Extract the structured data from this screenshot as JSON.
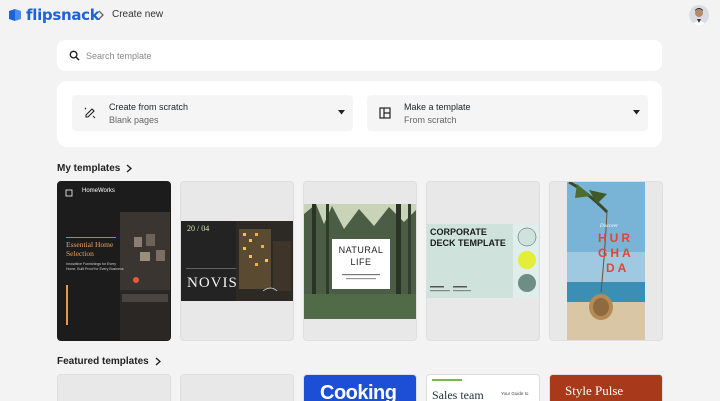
{
  "header": {
    "logo_text": "flipsnack",
    "brand_color": "#1d63d8",
    "breadcrumb_current": "Create new"
  },
  "search": {
    "placeholder": "Search template"
  },
  "create_options": [
    {
      "title": "Create from scratch",
      "subtitle": "Blank pages",
      "icon": "pencil-sparkle-icon"
    },
    {
      "title": "Make a template",
      "subtitle": "From scratch",
      "icon": "layout-icon"
    }
  ],
  "my_templates": {
    "title": "My templates",
    "items": [
      {
        "logo": "HomeWorks",
        "heading": "Essential Home Selection",
        "tagline": "Innovative Furnishings for Every Home, Built Proof for Every Business"
      },
      {
        "number": "20 / 04",
        "brand": "NOVIS"
      },
      {
        "title_line1": "NATURAL",
        "title_line2": "LIFE"
      },
      {
        "title_line1": "CORPORATE",
        "title_line2": "DECK TEMPLATE"
      },
      {
        "script_text": "Discover",
        "title_line1": "HUR",
        "title_line2": "GHA",
        "title_line3": "DA"
      }
    ]
  },
  "featured_templates": {
    "title": "Featured templates",
    "items": [
      {
        "text": ""
      },
      {
        "text": ""
      },
      {
        "text": "Cooking"
      },
      {
        "text": "Sales team",
        "side_text": "Your Guide to"
      },
      {
        "text": "Style Pulse"
      }
    ]
  }
}
